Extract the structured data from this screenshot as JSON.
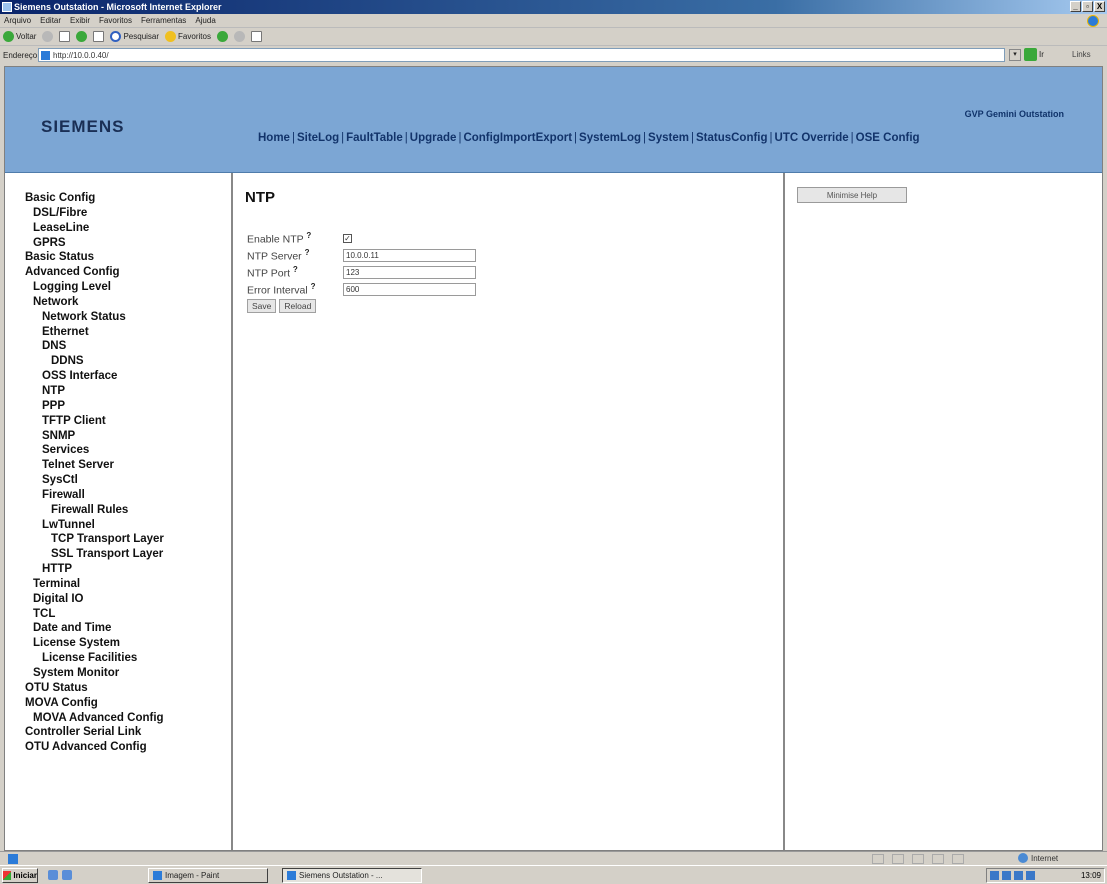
{
  "window": {
    "title": "Siemens Outstation - Microsoft Internet Explorer",
    "buttons": [
      "_",
      "▫",
      "X"
    ]
  },
  "menubar": [
    "Arquivo",
    "Editar",
    "Exibir",
    "Favoritos",
    "Ferramentas",
    "Ajuda"
  ],
  "toolbar": {
    "back": "Voltar",
    "search": "Pesquisar",
    "favorites": "Favoritos"
  },
  "addressbar": {
    "label": "Endereço",
    "url": "http://10.0.0.40/",
    "go": "Ir",
    "links": "Links"
  },
  "header": {
    "logo": "SIEMENS",
    "product": "GVP Gemini Outstation",
    "nav": [
      "Home",
      "SiteLog",
      "FaultTable",
      "Upgrade",
      "ConfigImportExport",
      "SystemLog",
      "System",
      "StatusConfig",
      "UTC Override",
      "OSE Config"
    ]
  },
  "sidebar": {
    "items": [
      {
        "label": "Basic Config",
        "level": 0
      },
      {
        "label": "DSL/Fibre",
        "level": 1
      },
      {
        "label": "LeaseLine",
        "level": 1
      },
      {
        "label": "GPRS",
        "level": 1
      },
      {
        "label": "Basic Status",
        "level": 0
      },
      {
        "label": "Advanced Config",
        "level": 0
      },
      {
        "label": "Logging Level",
        "level": 1
      },
      {
        "label": "Network",
        "level": 1
      },
      {
        "label": "Network Status",
        "level": 2
      },
      {
        "label": "Ethernet",
        "level": 2
      },
      {
        "label": "DNS",
        "level": 2
      },
      {
        "label": "DDNS",
        "level": 3
      },
      {
        "label": "OSS Interface",
        "level": 2
      },
      {
        "label": "NTP",
        "level": 2
      },
      {
        "label": "PPP",
        "level": 2
      },
      {
        "label": "TFTP Client",
        "level": 2
      },
      {
        "label": "SNMP",
        "level": 2
      },
      {
        "label": "Services",
        "level": 2
      },
      {
        "label": "Telnet Server",
        "level": 2
      },
      {
        "label": "SysCtl",
        "level": 2
      },
      {
        "label": "Firewall",
        "level": 2
      },
      {
        "label": "Firewall Rules",
        "level": 3
      },
      {
        "label": "LwTunnel",
        "level": 2
      },
      {
        "label": "TCP Transport Layer",
        "level": 3
      },
      {
        "label": "SSL Transport Layer",
        "level": 3
      },
      {
        "label": "HTTP",
        "level": 2
      },
      {
        "label": "Terminal",
        "level": 1
      },
      {
        "label": "Digital IO",
        "level": 1
      },
      {
        "label": "TCL",
        "level": 1
      },
      {
        "label": "Date and Time",
        "level": 1
      },
      {
        "label": "License System",
        "level": 1
      },
      {
        "label": "License Facilities",
        "level": 2
      },
      {
        "label": "System Monitor",
        "level": 1
      },
      {
        "label": "OTU Status",
        "level": 0
      },
      {
        "label": "MOVA Config",
        "level": 0
      },
      {
        "label": "MOVA Advanced Config",
        "level": 1
      },
      {
        "label": "Controller Serial Link",
        "level": 0
      },
      {
        "label": "OTU Advanced Config",
        "level": 0
      }
    ]
  },
  "main": {
    "title": "NTP",
    "help_marker": "?",
    "fields": {
      "enable_ntp": {
        "label": "Enable NTP",
        "checked": true,
        "mark": "✓"
      },
      "ntp_server": {
        "label": "NTP Server",
        "value": "10.0.0.11"
      },
      "ntp_port": {
        "label": "NTP Port",
        "value": "123"
      },
      "error_interval": {
        "label": "Error Interval",
        "value": "600"
      }
    },
    "save_label": "Save",
    "reload_label": "Reload"
  },
  "help": {
    "minimise_label": "Minimise Help"
  },
  "statusbar": {
    "zone": "Internet"
  },
  "taskbar": {
    "start": "Iniciar",
    "tasks": [
      "Imagem - Paint",
      "Siemens Outstation - ..."
    ],
    "clock": "13:09"
  },
  "colors": {
    "header_bg": "#7ca6d4",
    "nav_text": "#12336a"
  }
}
